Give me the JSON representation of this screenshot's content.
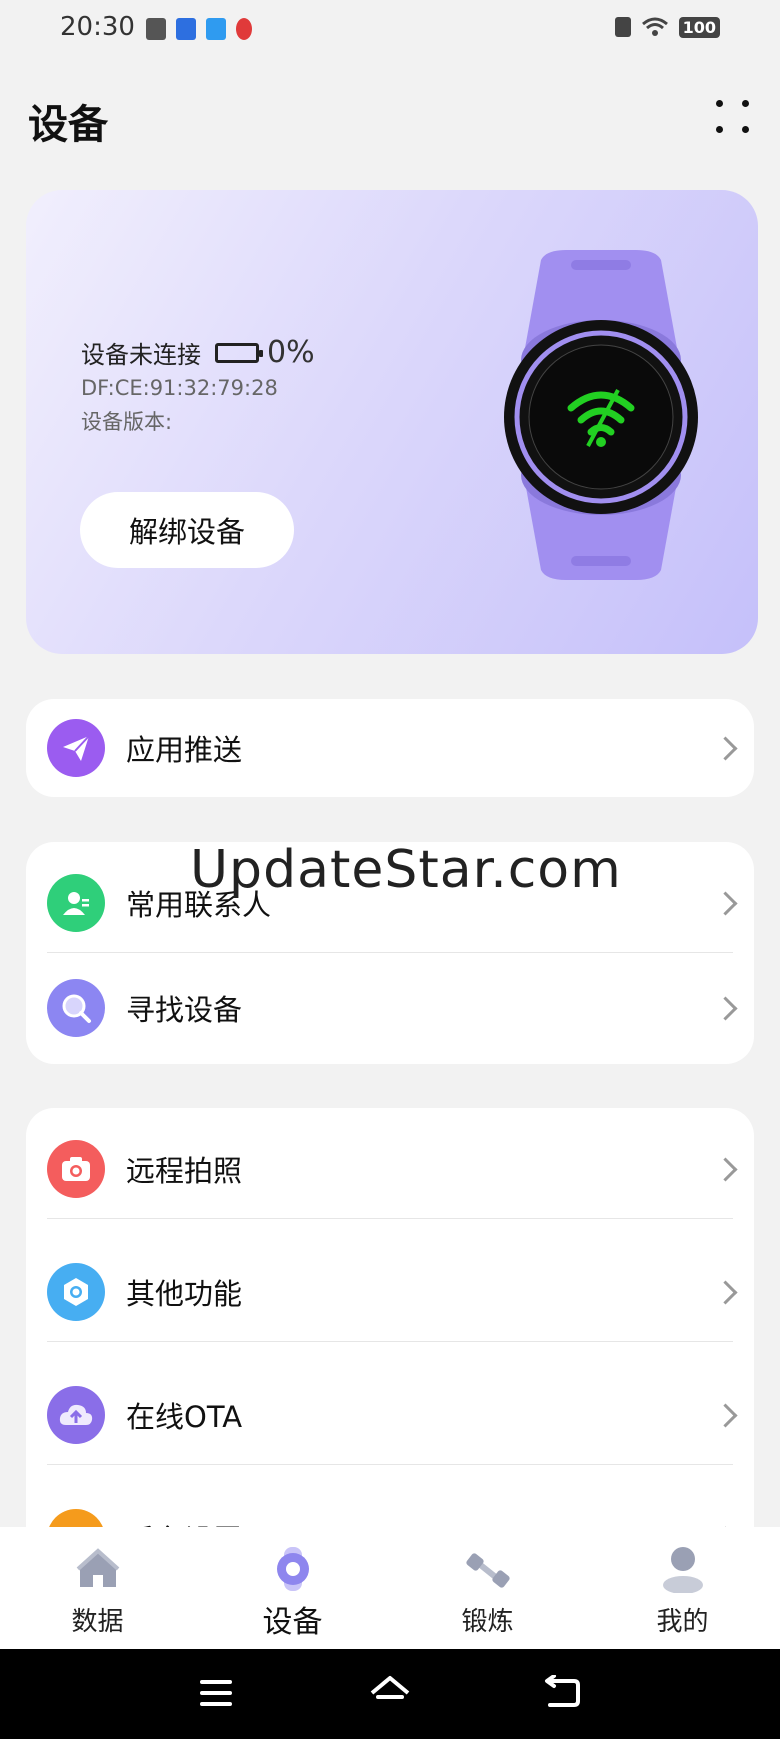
{
  "status_bar": {
    "time": "20:30",
    "battery": "100"
  },
  "header": {
    "title": "设备"
  },
  "device": {
    "connection_status": "设备未连接",
    "battery_percent": "0%",
    "mac": "DF:CE:91:32:79:28",
    "version_label": "设备版本:",
    "unbind_button": "解绑设备"
  },
  "menu": {
    "push": "应用推送",
    "contacts": "常用联系人",
    "find": "寻找设备",
    "camera": "远程拍照",
    "other": "其他功能",
    "ota": "在线OTA",
    "background": "后台设置"
  },
  "watermark": "UpdateStar.com",
  "nav": {
    "data": "数据",
    "device": "设备",
    "exercise": "锻炼",
    "mine": "我的"
  },
  "colors": {
    "push_icon": "#9b5cf0",
    "contacts_icon": "#2fcf7a",
    "find_icon": "#8c86f2",
    "camera_icon": "#f45d5d",
    "other_icon": "#47aef2",
    "ota_icon": "#8a6ee8",
    "background_icon": "#f59b1c",
    "accent": "#8e86ee"
  }
}
